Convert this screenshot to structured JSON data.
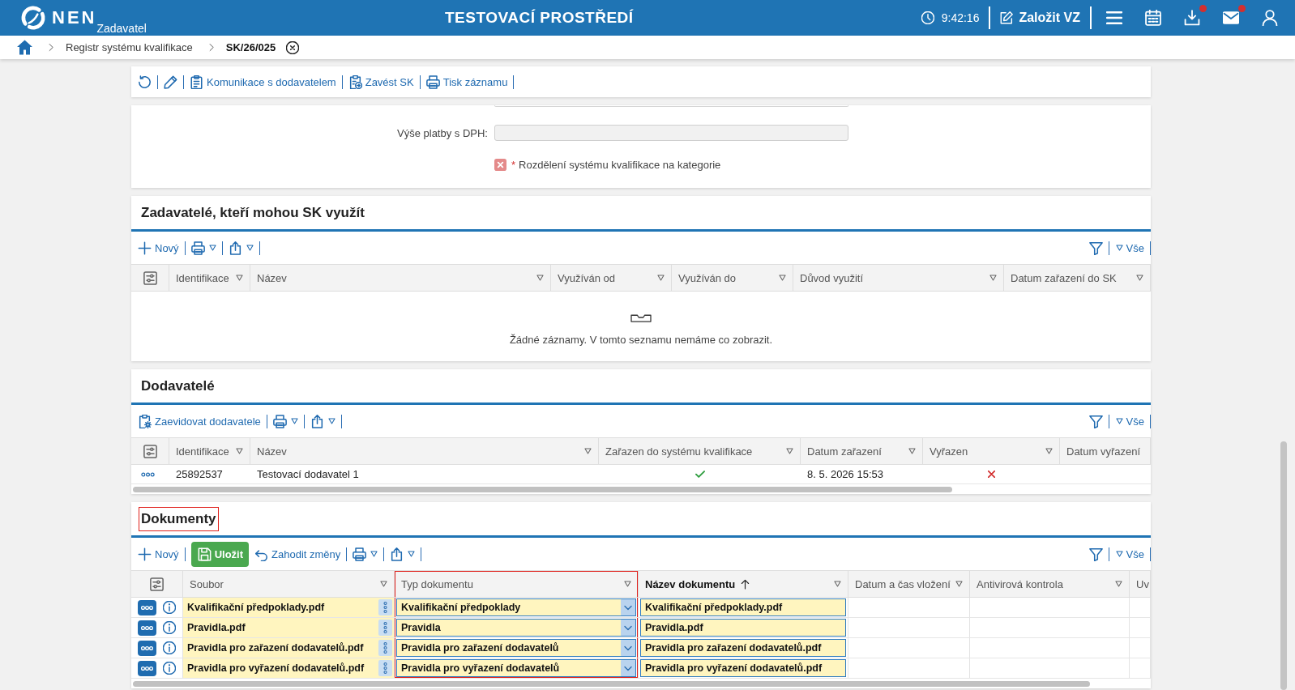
{
  "header": {
    "logo_text": "NEN",
    "logo_subtitle": "Zadavatel",
    "environment": "TESTOVACÍ PROSTŘEDÍ",
    "clock": "9:42:16",
    "create_button": "Založit VZ",
    "icons": [
      {
        "kind": "menu",
        "notification": false
      },
      {
        "kind": "calendar",
        "notification": false
      },
      {
        "kind": "download",
        "notification": true
      },
      {
        "kind": "mail",
        "notification": true
      },
      {
        "kind": "user",
        "notification": false
      }
    ]
  },
  "breadcrumb": [
    {
      "label": "Registr systému kvalifikace",
      "current": false
    },
    {
      "label": "SK/26/025",
      "current": true
    }
  ],
  "toolbar": [
    {
      "kind": "refresh",
      "dropdown": false
    },
    {
      "kind": "edit",
      "dropdown": false
    },
    {
      "kind": "communication",
      "label": "Komunikace s dodavatelem",
      "dropdown": false
    },
    {
      "kind": "establish",
      "label": "Zavést SK",
      "dropdown": false
    },
    {
      "kind": "print",
      "label": "Tisk záznamu",
      "dropdown": false
    }
  ],
  "form": {
    "fields": [
      {
        "label": "Výše platby s DPH:",
        "disabled": true
      }
    ],
    "checkbox": {
      "label": "Rozdělení systému kvalifikace na kategorie",
      "required_mark": "*",
      "checked": false
    }
  },
  "sections": [
    {
      "title": "Zadavatelé, kteří mohou SK využít",
      "outlined": false,
      "toolbar": [
        {
          "kind": "new",
          "label": "Nový",
          "dropdown": false
        },
        {
          "kind": "print",
          "dropdown": true
        },
        {
          "kind": "export",
          "dropdown": true
        }
      ],
      "filter_label": "Vše",
      "columns": [
        {
          "label": "Identifikace",
          "filter": true,
          "sorted": false,
          "outlined": false
        },
        {
          "label": "Název",
          "filter": true,
          "sorted": false,
          "outlined": false
        },
        {
          "label": "Využíván od",
          "filter": true,
          "sorted": false,
          "outlined": false
        },
        {
          "label": "Využíván do",
          "filter": true,
          "sorted": false,
          "outlined": false
        },
        {
          "label": "Důvod využití",
          "filter": true,
          "sorted": false,
          "outlined": false
        },
        {
          "label": "Datum zařazení do SK",
          "filter": true,
          "sorted": false,
          "outlined": false
        }
      ],
      "empty_message": "Žádné záznamy. V tomto seznamu nemáme co zobrazit."
    },
    {
      "title": "Dodavatelé",
      "outlined": false,
      "toolbar": [
        {
          "kind": "register_supplier",
          "label": "Zaevidovat dodavatele",
          "dropdown": false
        },
        {
          "kind": "print",
          "dropdown": true
        },
        {
          "kind": "export",
          "dropdown": true
        }
      ],
      "filter_label": "Vše",
      "columns": [
        {
          "label": "Identifikace",
          "filter": true,
          "sorted": false,
          "outlined": false
        },
        {
          "label": "Název",
          "filter": true,
          "sorted": false,
          "outlined": false
        },
        {
          "label": "Zařazen do systému kvalifikace",
          "filter": true,
          "sorted": false,
          "outlined": false
        },
        {
          "label": "Datum zařazení",
          "filter": true,
          "sorted": false,
          "outlined": false
        },
        {
          "label": "Vyřazen",
          "filter": true,
          "sorted": false,
          "outlined": false
        },
        {
          "label": "Datum vyřazení",
          "filter": false,
          "sorted": false,
          "outlined": false
        }
      ],
      "rows": [
        {
          "kind": "plain",
          "info": false,
          "cells": [
            {
              "kind": "text",
              "text": "25892537"
            },
            {
              "kind": "text",
              "text": "Testovací dodavatel 1"
            },
            {
              "kind": "flag",
              "checked": true
            },
            {
              "kind": "text",
              "text": "8. 5. 2026 15:53"
            },
            {
              "kind": "flag",
              "checked": false
            }
          ]
        }
      ]
    },
    {
      "title": "Dokumenty",
      "outlined": true,
      "toolbar": [
        {
          "kind": "new",
          "label": "Nový",
          "dropdown": false
        },
        {
          "kind": "save",
          "label": "Uložit",
          "dropdown": false
        },
        {
          "kind": "discard",
          "label": "Zahodit změny",
          "dropdown": false
        },
        {
          "kind": "print",
          "dropdown": true
        },
        {
          "kind": "export",
          "dropdown": true
        }
      ],
      "filter_label": "Vše",
      "columns": [
        {
          "label": "Soubor",
          "filter": true,
          "sorted": false,
          "outlined": false
        },
        {
          "label": "Typ dokumentu",
          "filter": true,
          "sorted": false,
          "outlined": true
        },
        {
          "label": "Název dokumentu",
          "filter": true,
          "sorted": true,
          "outlined": false
        },
        {
          "label": "Datum a čas vložení",
          "filter": true,
          "sorted": false,
          "outlined": false
        },
        {
          "label": "Antivirová kontrola",
          "filter": true,
          "sorted": false,
          "outlined": false
        },
        {
          "label": "Uv",
          "filter": false,
          "sorted": false,
          "outlined": false
        }
      ],
      "rows": [
        {
          "kind": "editable",
          "info": true,
          "cells": [
            {
              "kind": "file",
              "text": "Kvalifikační předpoklady.pdf"
            },
            {
              "kind": "select",
              "text": "Kvalifikační předpoklady"
            },
            {
              "kind": "input",
              "text": "Kvalifikační předpoklady.pdf"
            }
          ]
        },
        {
          "kind": "editable",
          "info": true,
          "cells": [
            {
              "kind": "file",
              "text": "Pravidla.pdf"
            },
            {
              "kind": "select",
              "text": "Pravidla"
            },
            {
              "kind": "input",
              "text": "Pravidla.pdf"
            }
          ]
        },
        {
          "kind": "editable",
          "info": true,
          "cells": [
            {
              "kind": "file",
              "text": "Pravidla pro zařazení dodavatelů.pdf"
            },
            {
              "kind": "select",
              "text": "Pravidla pro zařazení dodavatelů"
            },
            {
              "kind": "input",
              "text": "Pravidla pro zařazení dodavatelů.pdf"
            }
          ]
        },
        {
          "kind": "editable",
          "info": true,
          "cells": [
            {
              "kind": "file",
              "text": "Pravidla pro vyřazení dodavatelů.pdf"
            },
            {
              "kind": "select",
              "text": "Pravidla pro vyřazení dodavatelů"
            },
            {
              "kind": "input",
              "text": "Pravidla pro vyřazení dodavatelů.pdf"
            }
          ]
        }
      ]
    }
  ]
}
